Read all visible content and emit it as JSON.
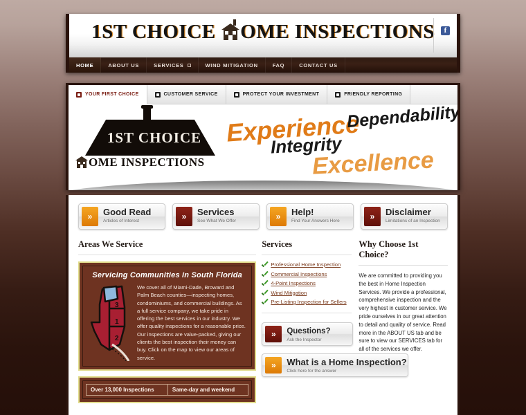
{
  "header": {
    "logo_prefix": "1ST CHOICE ",
    "logo_house_icon": "house-icon",
    "logo_suffix": "OME INSPECTIONS",
    "facebook_icon": "facebook-icon",
    "facebook_glyph": "f"
  },
  "nav": {
    "items": [
      {
        "label": "HOME",
        "active": true,
        "has_caret": false
      },
      {
        "label": "ABOUT US",
        "active": false,
        "has_caret": false
      },
      {
        "label": "SERVICES",
        "active": false,
        "has_caret": true
      },
      {
        "label": "WIND MITIGATION",
        "active": false,
        "has_caret": false
      },
      {
        "label": "FAQ",
        "active": false,
        "has_caret": false
      },
      {
        "label": "CONTACT US",
        "active": false,
        "has_caret": false
      }
    ]
  },
  "tabs": [
    {
      "label": "YOUR FIRST CHOICE",
      "active": true
    },
    {
      "label": "CUSTOMER SERVICE",
      "active": false
    },
    {
      "label": "PROTECT YOUR INVESTMENT",
      "active": false
    },
    {
      "label": "FRIENDLY REPORTING",
      "active": false
    }
  ],
  "banner": {
    "roof_label": "1ST CHOICE",
    "sub_label": "OME INSPECTIONS",
    "house_icon": "house-icon",
    "words": [
      {
        "text": "Experience",
        "color": "#e07b18"
      },
      {
        "text": "Dependability",
        "color": "#171717"
      },
      {
        "text": "Integrity",
        "color": "#1b1b1b"
      },
      {
        "text": "Excellence",
        "color": "#e89b43"
      }
    ]
  },
  "promos": [
    {
      "title": "Good Read",
      "sub": "Articles of Interest",
      "icon": "chevron-double-right-icon",
      "color": "orange"
    },
    {
      "title": "Services",
      "sub": "See What We Offer",
      "icon": "chevron-double-right-icon",
      "color": "maroon"
    },
    {
      "title": "Help!",
      "sub": "Find Your Answers Here",
      "icon": "chevron-double-right-icon",
      "color": "orange"
    },
    {
      "title": "Disclaimer",
      "sub": "Limitations of an Inspection",
      "icon": "chevron-double-right-icon",
      "color": "maroon"
    }
  ],
  "columns": {
    "left_heading": "Areas We Service",
    "mid_heading": "Services",
    "right_heading": "Why Choose 1st Choice?"
  },
  "map": {
    "title": "Servicing Communities in South Florida",
    "body": "We cover all of Miami-Dade, Broward and Palm Beach counties—inspecting homes, condominiums, and commercial buildings. As a full service company, we take pride in offering the best services in our industry. We offer quality inspections for a reasonable price. Our inspections are value-packed, giving our clients the best inspection their money can buy.  Click on the map to view our areas of service.",
    "region_labels": [
      "3",
      "1",
      "2"
    ]
  },
  "stats": {
    "rows": [
      [
        "Over 13,000 Inspections",
        "Same-day and weekend"
      ]
    ]
  },
  "services_list": [
    "Professional Home Inspection",
    "Commercial Inspections",
    "4-Point Inspections",
    "Wind Mitigation",
    "Pre-Listing Inspection for Sellers"
  ],
  "questions_promo": {
    "title": "Questions?",
    "sub": "Ask the Inspector",
    "icon": "chevron-double-right-icon",
    "color": "maroon"
  },
  "what_is_promo": {
    "title": "What is a Home Inspection?",
    "sub": "Click here for the answer",
    "icon": "chevron-double-right-icon",
    "color": "orange"
  },
  "why_choose_text": "We are committed to providing you the best in Home Inspection Services. We provide a professional, comprehensive inspection and the very highest in customer service. We pride ourselves in our great attention to detail and quality of service. Read more in the ABOUT US tab and be sure to view our SERVICES tab for all of the services we offer."
}
